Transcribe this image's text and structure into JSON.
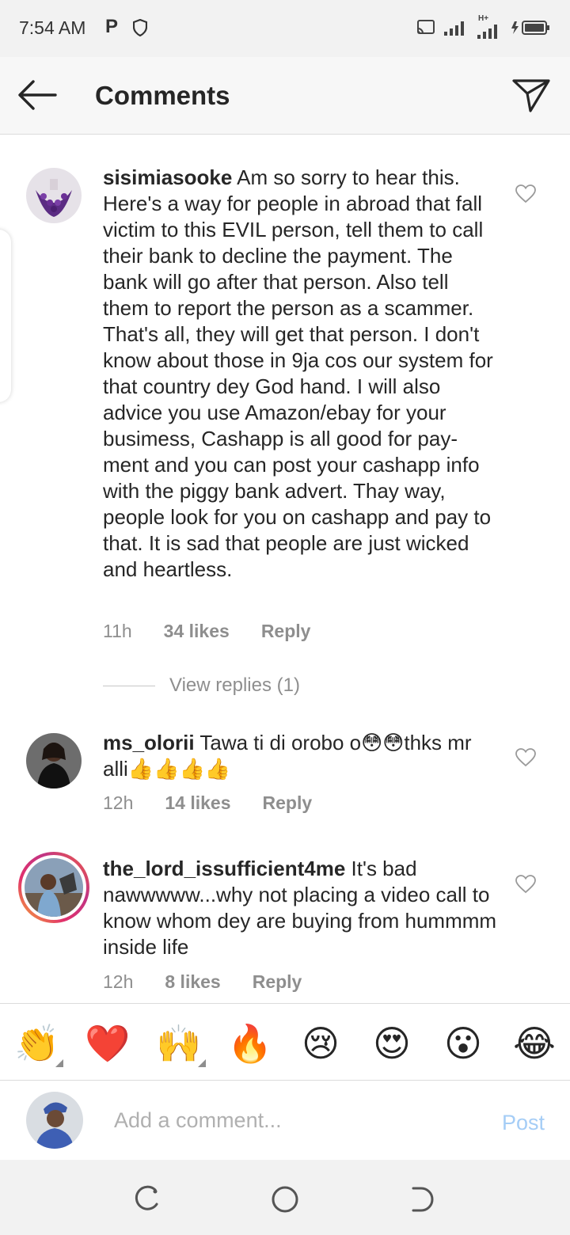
{
  "status_bar": {
    "time": "7:54 AM",
    "p_icon": "P",
    "network_label": "H+",
    "icons": [
      "parking-icon",
      "shield-icon",
      "cast-icon",
      "signal-icon",
      "battery-icon"
    ]
  },
  "header": {
    "title": "Comments",
    "back_icon": "arrow-left-icon",
    "send_icon": "paper-plane-icon"
  },
  "comments": [
    {
      "username": "sisimiasooke",
      "text": "Am so sorry to hear this. Here's a way for people in abroad that fall victim to this EVIL person, tell them to call their bank to decline the payment. The bank will go after that person. Also tell them to report the person as a scammer. That's all, they will get that person. I don't know about those in 9ja cos our system for that country dey God hand. I will also advice you use Amazon/ebay for your busimess, Cashapp is all good for pay-ment and you can post your cashapp info with the piggy bank advert. Thay way, people look for you on cashapp and pay to that. It is sad that people are just wicked and heartless.",
      "time": "11h",
      "likes": "34 likes",
      "reply": "Reply",
      "view_replies": "View replies (1)"
    },
    {
      "username": "ms_olorii",
      "text": "Tawa ti di orobo o😳😳thks mr alli👍👍👍👍",
      "time": "12h",
      "likes": "14 likes",
      "reply": "Reply"
    },
    {
      "username": "the_lord_issufficient4me",
      "text": "It's bad nawwwww...why not placing a video call to know whom dey are buying from hummmm inside life",
      "time": "12h",
      "likes": "8 likes",
      "reply": "Reply"
    }
  ],
  "emoji_bar": [
    "👏",
    "❤️",
    "🙌",
    "🔥",
    "😢",
    "😍",
    "😮",
    "😂"
  ],
  "input": {
    "placeholder": "Add a comment...",
    "post_label": "Post"
  },
  "colors": {
    "post_disabled": "#a5cdf6",
    "meta_gray": "#8e8e8e",
    "story_ring": "#e1306c"
  }
}
